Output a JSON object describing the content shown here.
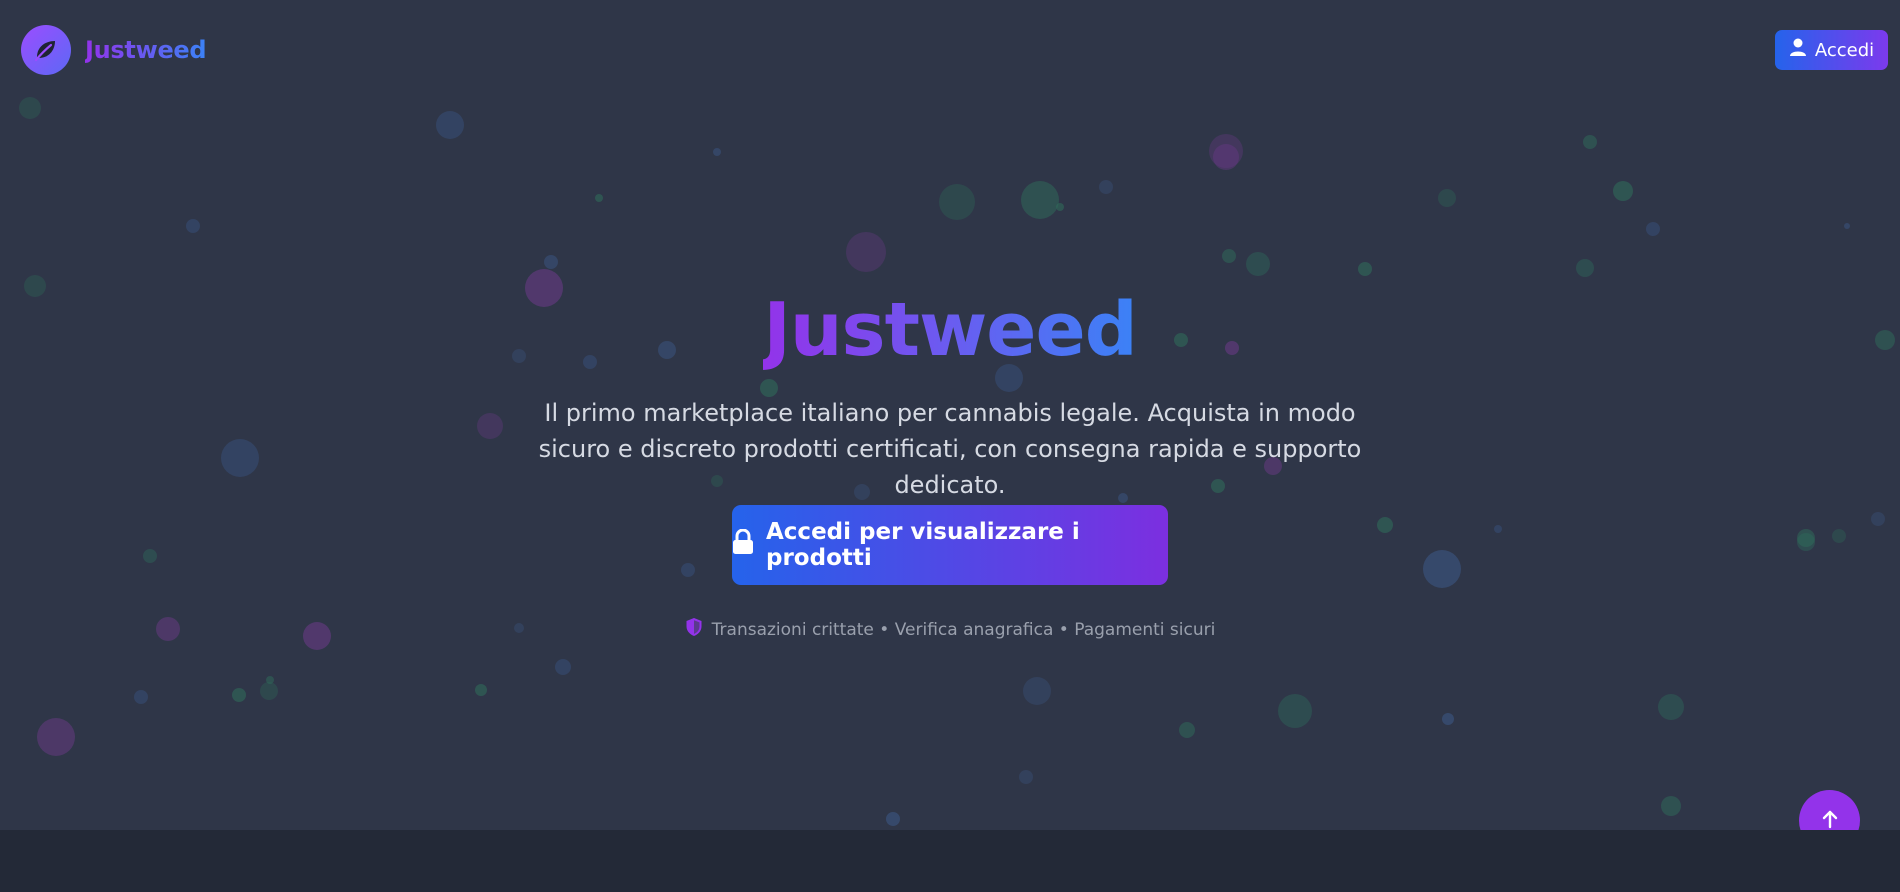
{
  "header": {
    "brand": "Justweed",
    "login_label": "Accedi",
    "logo_icon": "leaf-icon",
    "login_icon": "user-icon"
  },
  "hero": {
    "title": "Justweed",
    "subtitle": "Il primo marketplace italiano per cannabis legale. Acquista in modo sicuro e discreto prodotti certificati, con consegna rapida e supporto dedicato.",
    "cta_label": "Accedi per visualizzare i prodotti",
    "cta_icon": "lock-icon",
    "security_text": "Transazioni crittate • Verifica anagrafica • Pagamenti sicuri",
    "security_icon": "shield-icon"
  },
  "scroll_top": {
    "icon": "arrow-up-icon"
  },
  "colors": {
    "background": "#2f3648",
    "footer": "#232937",
    "accent_purple": "#9333ea",
    "accent_blue": "#3b82f6",
    "bubble_green": "#2f6b5a",
    "bubble_purple": "#6a3a86",
    "bubble_blue": "#3b5684"
  }
}
